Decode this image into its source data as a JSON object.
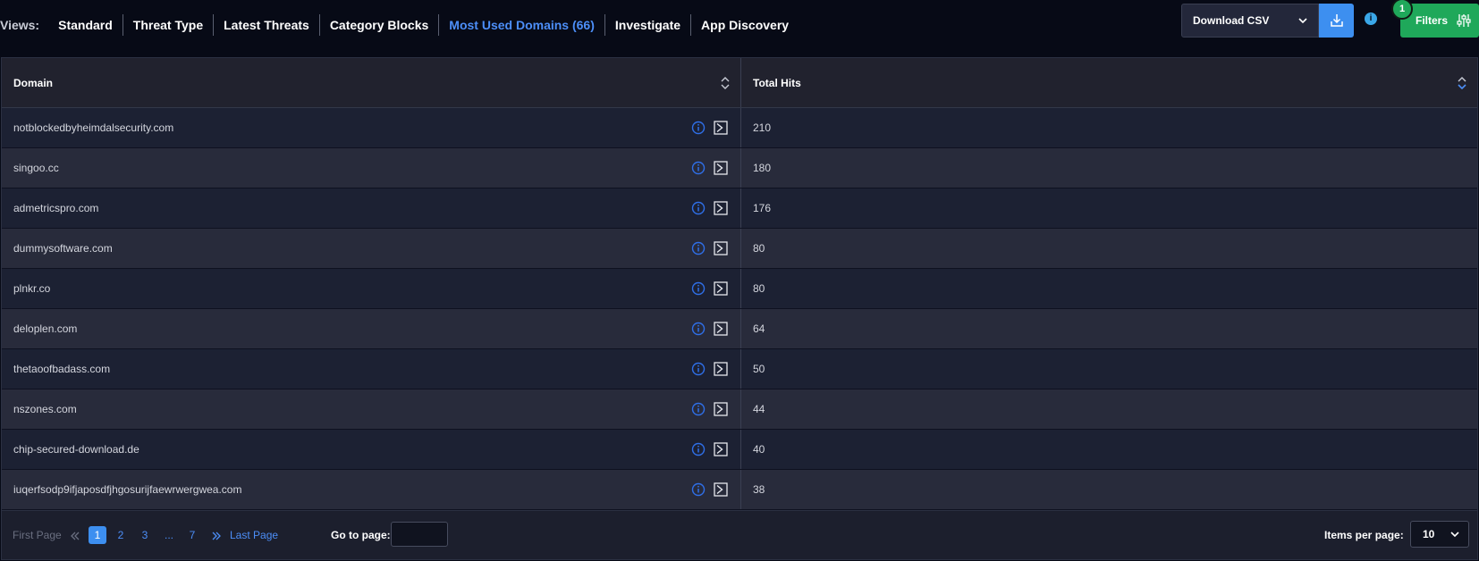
{
  "views": {
    "label": "Views:",
    "tabs": [
      {
        "label": "Standard",
        "active": false
      },
      {
        "label": "Threat Type",
        "active": false
      },
      {
        "label": "Latest Threats",
        "active": false
      },
      {
        "label": "Category Blocks",
        "active": false
      },
      {
        "label": "Most Used Domains (66)",
        "active": true
      },
      {
        "label": "Investigate",
        "active": false
      },
      {
        "label": "App Discovery",
        "active": false
      }
    ]
  },
  "toolbar": {
    "download_label": "Download CSV",
    "filters_label": "Filters",
    "filters_badge": "1",
    "info_glyph": "i"
  },
  "table": {
    "headers": {
      "domain": "Domain",
      "total_hits": "Total Hits"
    },
    "rows": [
      {
        "domain": "notblockedbyheimdalsecurity.com",
        "hits": "210"
      },
      {
        "domain": "singoo.cc",
        "hits": "180"
      },
      {
        "domain": "admetricspro.com",
        "hits": "176"
      },
      {
        "domain": "dummysoftware.com",
        "hits": "80"
      },
      {
        "domain": "plnkr.co",
        "hits": "80"
      },
      {
        "domain": "deloplen.com",
        "hits": "64"
      },
      {
        "domain": "thetaoofbadass.com",
        "hits": "50"
      },
      {
        "domain": "nszones.com",
        "hits": "44"
      },
      {
        "domain": "chip-secured-download.de",
        "hits": "40"
      },
      {
        "domain": "iuqerfsodp9ifjaposdfjhgosurijfaewrwergwea.com",
        "hits": "38"
      }
    ]
  },
  "pagination": {
    "first_label": "First Page",
    "last_label": "Last Page",
    "pages": [
      "1",
      "2",
      "3",
      "...",
      "7"
    ],
    "current": "1",
    "goto_label": "Go to page:",
    "items_per_page_label": "Items per page:",
    "items_per_page": "10"
  },
  "colors": {
    "accent": "#4c8ef7",
    "filters": "#1fa85a",
    "background": "#070a16"
  }
}
